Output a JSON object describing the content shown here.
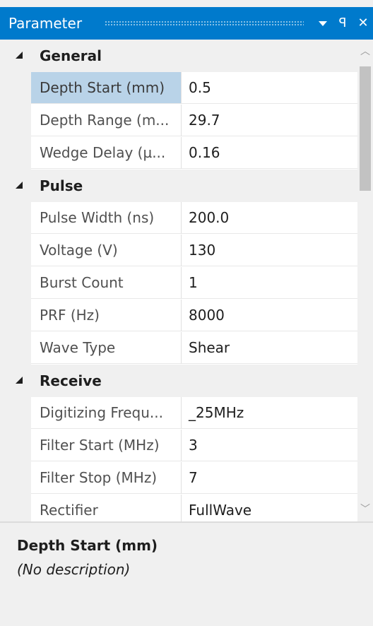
{
  "window": {
    "title": "Parameter",
    "dropdown_icon": "chevron-down-icon",
    "pin_glyph": "ꟼ",
    "close_glyph": "✕"
  },
  "grid": {
    "categories": [
      {
        "label": "General",
        "properties": [
          {
            "name": "Depth Start (mm)",
            "value": "0.5"
          },
          {
            "name": "Depth Range (m...",
            "value": "29.7"
          },
          {
            "name": "Wedge Delay (µ...",
            "value": "0.16"
          }
        ]
      },
      {
        "label": "Pulse",
        "properties": [
          {
            "name": "Pulse Width (ns)",
            "value": "200.0"
          },
          {
            "name": "Voltage (V)",
            "value": "130"
          },
          {
            "name": "Burst Count",
            "value": "1"
          },
          {
            "name": "PRF (Hz)",
            "value": "8000"
          },
          {
            "name": "Wave Type",
            "value": "Shear"
          }
        ]
      },
      {
        "label": "Receive",
        "properties": [
          {
            "name": "Digitizing Frequ...",
            "value": "_25MHz"
          },
          {
            "name": "Filter Start (MHz)",
            "value": "3"
          },
          {
            "name": "Filter Stop (MHz)",
            "value": "7"
          },
          {
            "name": "Rectifier",
            "value": "FullWave"
          }
        ]
      }
    ],
    "selected_property": "Depth Start (mm)"
  },
  "description": {
    "title": "Depth Start (mm)",
    "text": "(No description)"
  },
  "colors": {
    "titlebar": "#007acc",
    "selection": "#b9d3e8",
    "panel_bg": "#f0f0f0"
  }
}
